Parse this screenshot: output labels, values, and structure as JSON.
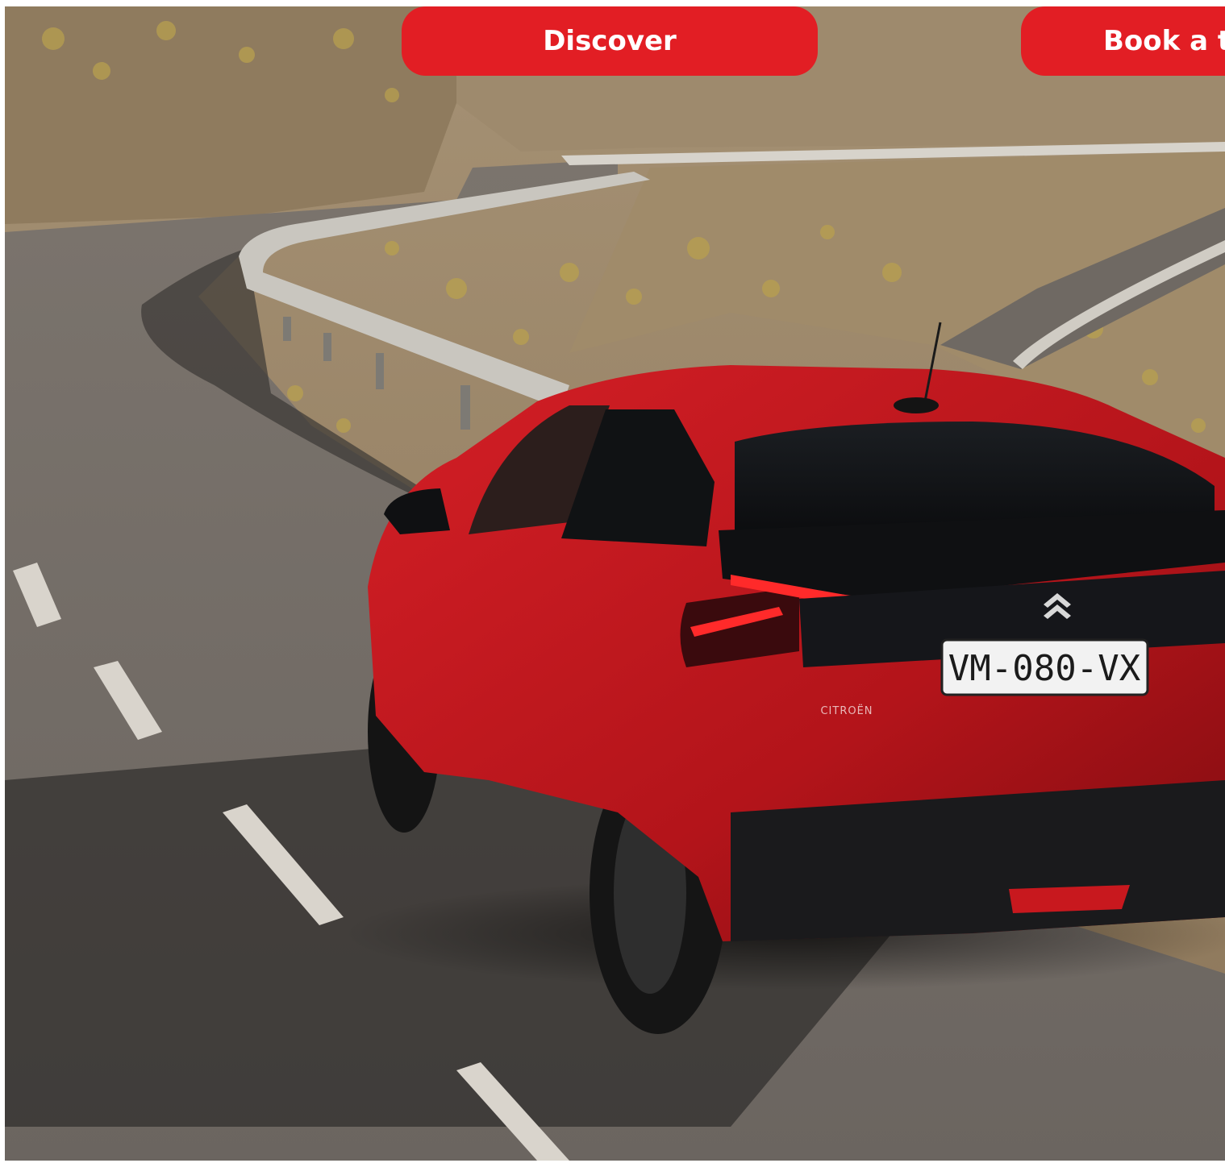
{
  "hero": {
    "image_label": "Red Citroën SUV driving on a winding mountain road",
    "plate_text": "VM-080-VX",
    "badge_text": "CITROËN"
  },
  "cta": {
    "discover_label": "Discover",
    "book_label": "Book a test drive"
  },
  "colors": {
    "cta_red": "#e21e24",
    "car_red": "#c4161c",
    "road": "#6e6862",
    "hillside": "#9a8567"
  }
}
